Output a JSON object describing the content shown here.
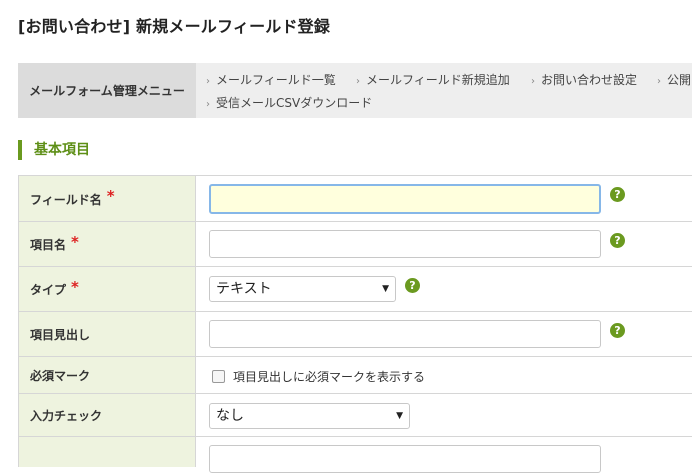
{
  "page": {
    "title": "[お問い合わせ] 新規メールフィールド登録"
  },
  "menu": {
    "label": "メールフォーム管理メニュー",
    "links": [
      "メールフィールド一覧",
      "メールフィールド新規追加",
      "お問い合わせ設定",
      "公開",
      "受信メールCSVダウンロード"
    ]
  },
  "section": {
    "title": "基本項目"
  },
  "fields": {
    "field_name": {
      "label": "フィールド名",
      "required": "*",
      "value": ""
    },
    "item_name": {
      "label": "項目名",
      "required": "*",
      "value": ""
    },
    "type": {
      "label": "タイプ",
      "required": "*",
      "selected": "テキスト"
    },
    "heading": {
      "label": "項目見出し",
      "value": ""
    },
    "required_mark": {
      "label": "必須マーク",
      "checkbox_label": "項目見出しに必須マークを表示する"
    },
    "validation": {
      "label": "入力チェック",
      "selected": "なし"
    }
  },
  "help": "?",
  "colors": {
    "accent": "#6a9a1f",
    "label_bg": "#eef3df",
    "required": "#dd2222"
  }
}
